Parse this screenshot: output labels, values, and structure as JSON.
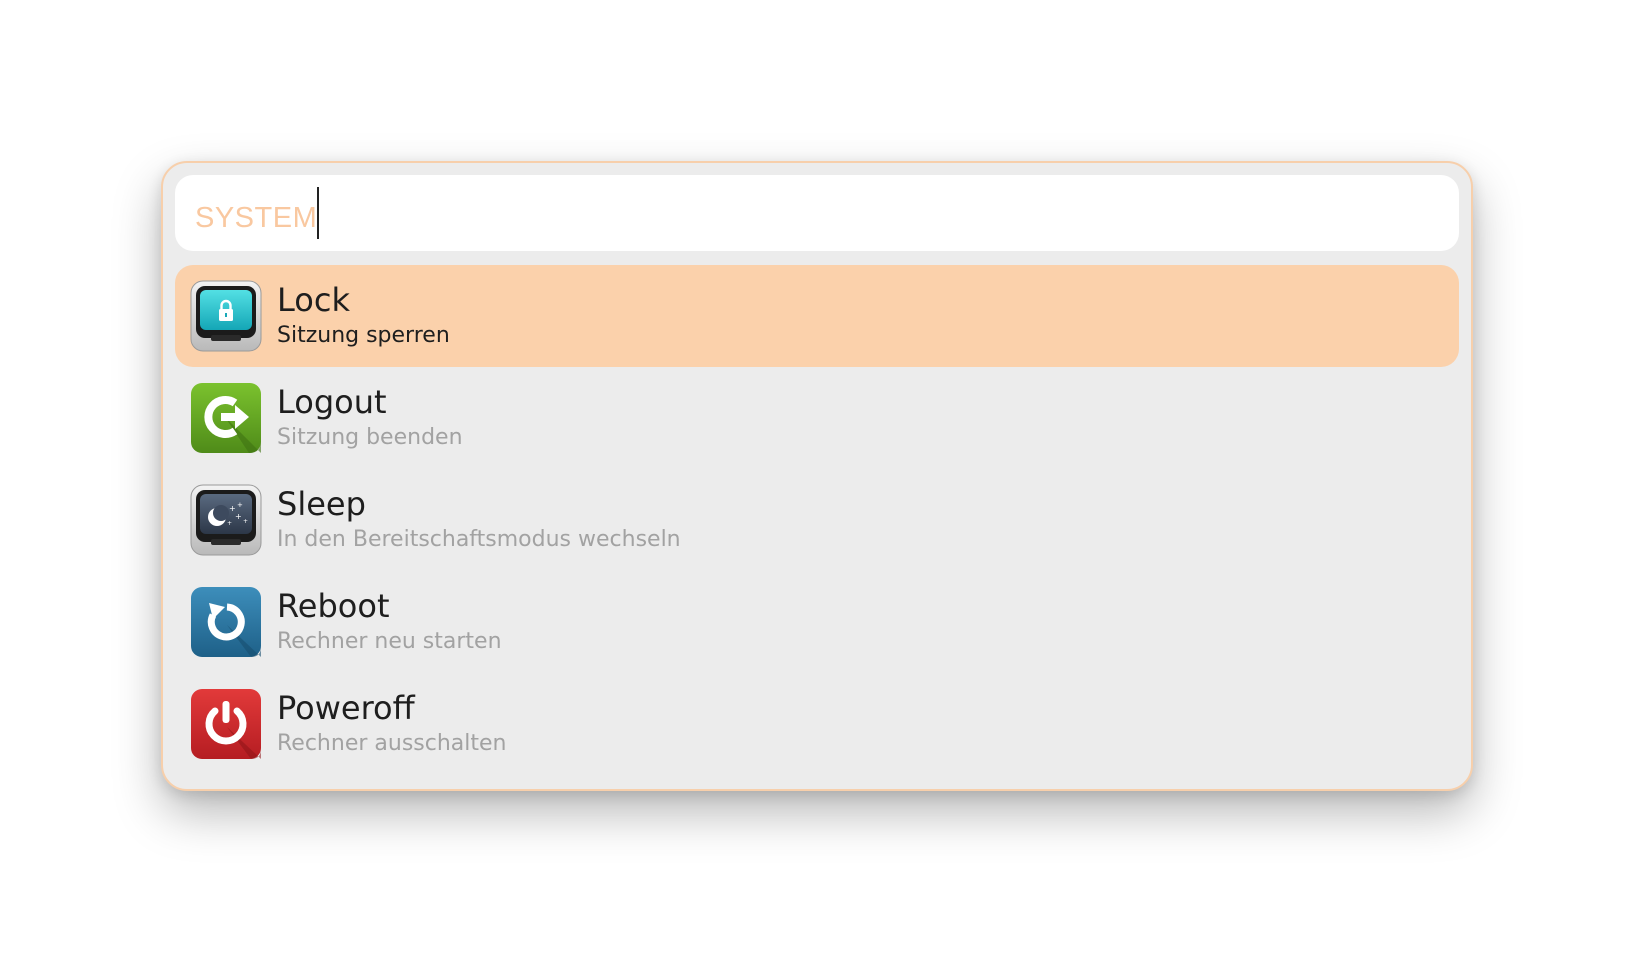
{
  "launcher": {
    "mode_label": "SYSTEM",
    "query": "",
    "colors": {
      "accent": "#fbd1ab",
      "border": "#f7cfab",
      "mode_label": "#f9c8a0",
      "background": "#ececec"
    }
  },
  "results": [
    {
      "title": "Lock",
      "subtitle": "Sitzung sperren",
      "icon": "lock-screen-icon",
      "selected": true
    },
    {
      "title": "Logout",
      "subtitle": "Sitzung beenden",
      "icon": "logout-arrow-icon",
      "selected": false
    },
    {
      "title": "Sleep",
      "subtitle": "In den Bereitschaftsmodus wechseln",
      "icon": "sleep-moon-icon",
      "selected": false
    },
    {
      "title": "Reboot",
      "subtitle": "Rechner neu starten",
      "icon": "reboot-arrow-icon",
      "selected": false
    },
    {
      "title": "Poweroff",
      "subtitle": "Rechner ausschalten",
      "icon": "power-icon",
      "selected": false
    }
  ]
}
